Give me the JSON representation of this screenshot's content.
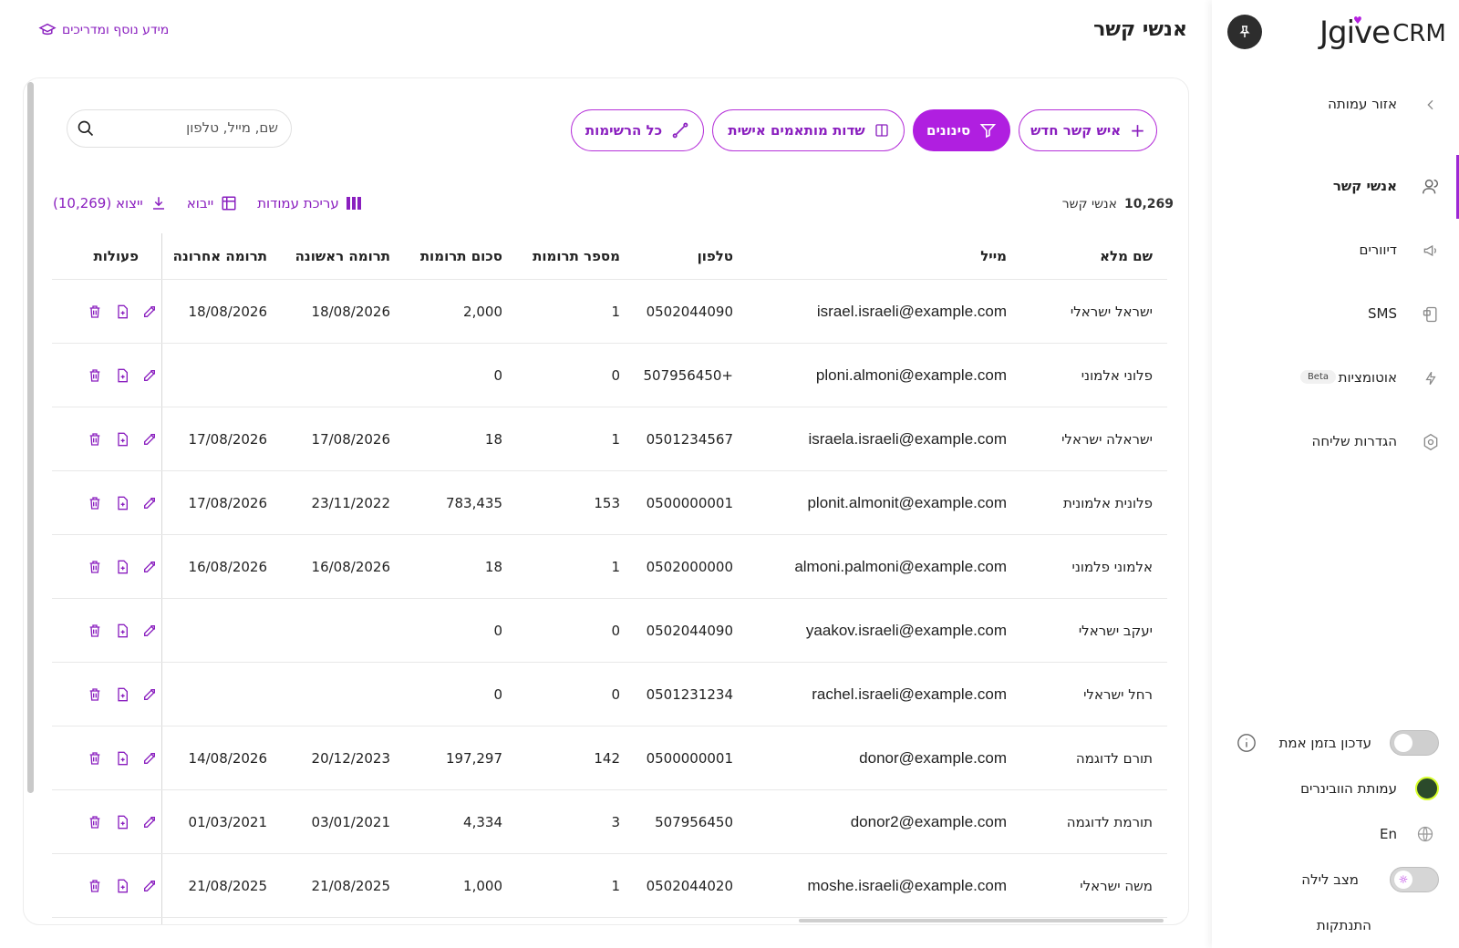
{
  "app": {
    "logo_text": "Jgive",
    "logo_suffix": "CRM"
  },
  "sidebar": {
    "items": [
      {
        "label": "אזור עמותה",
        "icon": "chevron-left-icon"
      },
      {
        "label": "אנשי קשר",
        "icon": "contacts-icon",
        "active": true
      },
      {
        "label": "דיוורים",
        "icon": "megaphone-icon"
      },
      {
        "label": "SMS",
        "icon": "sms-icon"
      },
      {
        "label": "אוטומציות",
        "icon": "automation-icon",
        "badge": "Beta"
      },
      {
        "label": "הגדרות שליחה",
        "icon": "settings-icon"
      }
    ],
    "realtime_label": "עדכון בזמן אמת",
    "org_label": "עמותת הוובינרים",
    "language_label": "En",
    "night_mode_label": "מצב לילה",
    "logout_label": "התנתקות"
  },
  "header": {
    "title": "אנשי קשר",
    "help_link": "מידע נוסף ומדריכים"
  },
  "toolbar": {
    "new_contact": "איש קשר חדש",
    "filters": "סינונים",
    "custom_fields": "שדות מותאמים אישית",
    "all_lists": "כל הרשימות",
    "search_placeholder": "שם, מייל, טלפון"
  },
  "summary": {
    "count": "10,269",
    "label": "אנשי קשר"
  },
  "actions": {
    "edit_columns": "עריכת עמודות",
    "import": "ייבוא",
    "export": "ייצוא (10,269)"
  },
  "table": {
    "headers": {
      "name": "שם מלא",
      "email": "מייל",
      "phone": "טלפון",
      "donations_count": "מספר תרומות",
      "donations_sum": "סכום תרומות",
      "first_donation": "תרומה ראשונה",
      "last_donation": "תרומה אחרונה",
      "actions": "פעולות"
    },
    "rows": [
      {
        "name": "ישראל ישראלי",
        "email": "israel.israeli@example.com",
        "phone": "0502044090",
        "count": "1",
        "sum": "2,000",
        "first": "18/08/2026",
        "last": "18/08/2026"
      },
      {
        "name": "פלוני אלמוני",
        "email": "ploni.almoni@example.com",
        "phone": "+507956450",
        "count": "0",
        "sum": "0",
        "first": "",
        "last": ""
      },
      {
        "name": "ישראלה ישראלי",
        "email": "israela.israeli@example.com",
        "phone": "0501234567",
        "count": "1",
        "sum": "18",
        "first": "17/08/2026",
        "last": "17/08/2026"
      },
      {
        "name": "פלונית אלמונית",
        "email": "plonit.almonit@example.com",
        "phone": "0500000001",
        "count": "153",
        "sum": "783,435",
        "first": "23/11/2022",
        "last": "17/08/2026"
      },
      {
        "name": "אלמוני פלמוני",
        "email": "almoni.palmoni@example.com",
        "phone": "0502000000",
        "count": "1",
        "sum": "18",
        "first": "16/08/2026",
        "last": "16/08/2026"
      },
      {
        "name": "יעקב ישראלי",
        "email": "yaakov.israeli@example.com",
        "phone": "0502044090",
        "count": "0",
        "sum": "0",
        "first": "",
        "last": ""
      },
      {
        "name": "רחל ישראלי",
        "email": "rachel.israeli@example.com",
        "phone": "0501231234",
        "count": "0",
        "sum": "0",
        "first": "",
        "last": ""
      },
      {
        "name": "תורם לדוגמה",
        "email": "donor@example.com",
        "phone": "0500000001",
        "count": "142",
        "sum": "197,297",
        "first": "20/12/2023",
        "last": "14/08/2026"
      },
      {
        "name": "תורמת לדוגמה",
        "email": "donor2@example.com",
        "phone": "507956450",
        "count": "3",
        "sum": "4,334",
        "first": "03/01/2021",
        "last": "01/03/2021"
      },
      {
        "name": "משה ישראלי",
        "email": "moshe.israeli@example.com",
        "phone": "0502044020",
        "count": "1",
        "sum": "1,000",
        "first": "21/08/2025",
        "last": "21/08/2025"
      }
    ]
  },
  "colors": {
    "accent": "#b01fe0",
    "accent_text": "#8a1fbf"
  }
}
